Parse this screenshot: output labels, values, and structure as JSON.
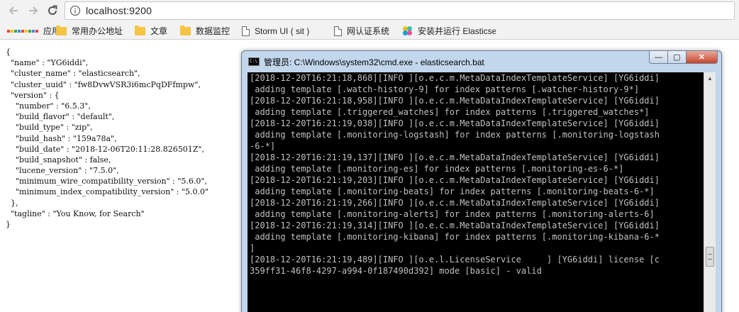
{
  "browser": {
    "url": "localhost:9200",
    "icons": {
      "back": "back-arrow-icon",
      "forward": "forward-arrow-icon",
      "reload": "reload-icon",
      "info": "info-icon"
    }
  },
  "bookmarks": [
    {
      "label": "应用",
      "icon": "apps-grid-icon"
    },
    {
      "label": "常用办公地址",
      "icon": "folder-icon"
    },
    {
      "label": "文章",
      "icon": "folder-icon"
    },
    {
      "label": "数据监控",
      "icon": "folder-icon"
    },
    {
      "label": "Storm UI ( sit )",
      "icon": "page-icon"
    },
    {
      "label": "网认证系统",
      "icon": "page-icon"
    },
    {
      "label": "安装并运行 Elasticse",
      "icon": "elastic-icon"
    }
  ],
  "json_lines": [
    "{",
    "  \"name\" : \"YG6iddi\",",
    "  \"cluster_name\" : \"elasticsearch\",",
    "  \"cluster_uuid\" : \"fw8DvwVSR3i6mcPqDFfmpw\",",
    "  \"version\" : {",
    "    \"number\" : \"6.5.3\",",
    "    \"build_flavor\" : \"default\",",
    "    \"build_type\" : \"zip\",",
    "    \"build_hash\" : \"159a78a\",",
    "    \"build_date\" : \"2018-12-06T20:11:28.826501Z\",",
    "    \"build_snapshot\" : false,",
    "    \"lucene_version\" : \"7.5.0\",",
    "    \"minimum_wire_compatibility_version\" : \"5.6.0\",",
    "    \"minimum_index_compatibility_version\" : \"5.0.0\"",
    "  },",
    "  \"tagline\" : \"You Know, for Search\"",
    "}"
  ],
  "cmd": {
    "title": "管理员: C:\\Windows\\system32\\cmd.exe - elasticsearch.bat",
    "icon": "cmd-icon",
    "min_label": "—",
    "max_label": "▢",
    "close_label": "✕",
    "lines": [
      "[2018-12-20T16:21:18,868][INFO ][o.e.c.m.MetaDataIndexTemplateService] [YG6iddi]",
      " adding template [.watch-history-9] for index patterns [.watcher-history-9*]",
      "[2018-12-20T16:21:18,958][INFO ][o.e.c.m.MetaDataIndexTemplateService] [YG6iddi]",
      " adding template [.triggered_watches] for index patterns [.triggered_watches*]",
      "[2018-12-20T16:21:19,038][INFO ][o.e.c.m.MetaDataIndexTemplateService] [YG6iddi]",
      " adding template [.monitoring-logstash] for index patterns [.monitoring-logstash",
      "-6-*]",
      "[2018-12-20T16:21:19,137][INFO ][o.e.c.m.MetaDataIndexTemplateService] [YG6iddi]",
      " adding template [.monitoring-es] for index patterns [.monitoring-es-6-*]",
      "[2018-12-20T16:21:19,203][INFO ][o.e.c.m.MetaDataIndexTemplateService] [YG6iddi]",
      " adding template [.monitoring-beats] for index patterns [.monitoring-beats-6-*]",
      "[2018-12-20T16:21:19,266][INFO ][o.e.c.m.MetaDataIndexTemplateService] [YG6iddi]",
      " adding template [.monitoring-alerts] for index patterns [.monitoring-alerts-6]",
      "[2018-12-20T16:21:19,314][INFO ][o.e.c.m.MetaDataIndexTemplateService] [YG6iddi]",
      " adding template [.monitoring-kibana] for index patterns [.monitoring-kibana-6-*",
      "]",
      "[2018-12-20T16:21:19,489][INFO ][o.e.l.LicenseService     ] [YG6iddi] license [c",
      "359ff31-46f8-4297-a994-0f187490d392] mode [basic] - valid"
    ]
  }
}
